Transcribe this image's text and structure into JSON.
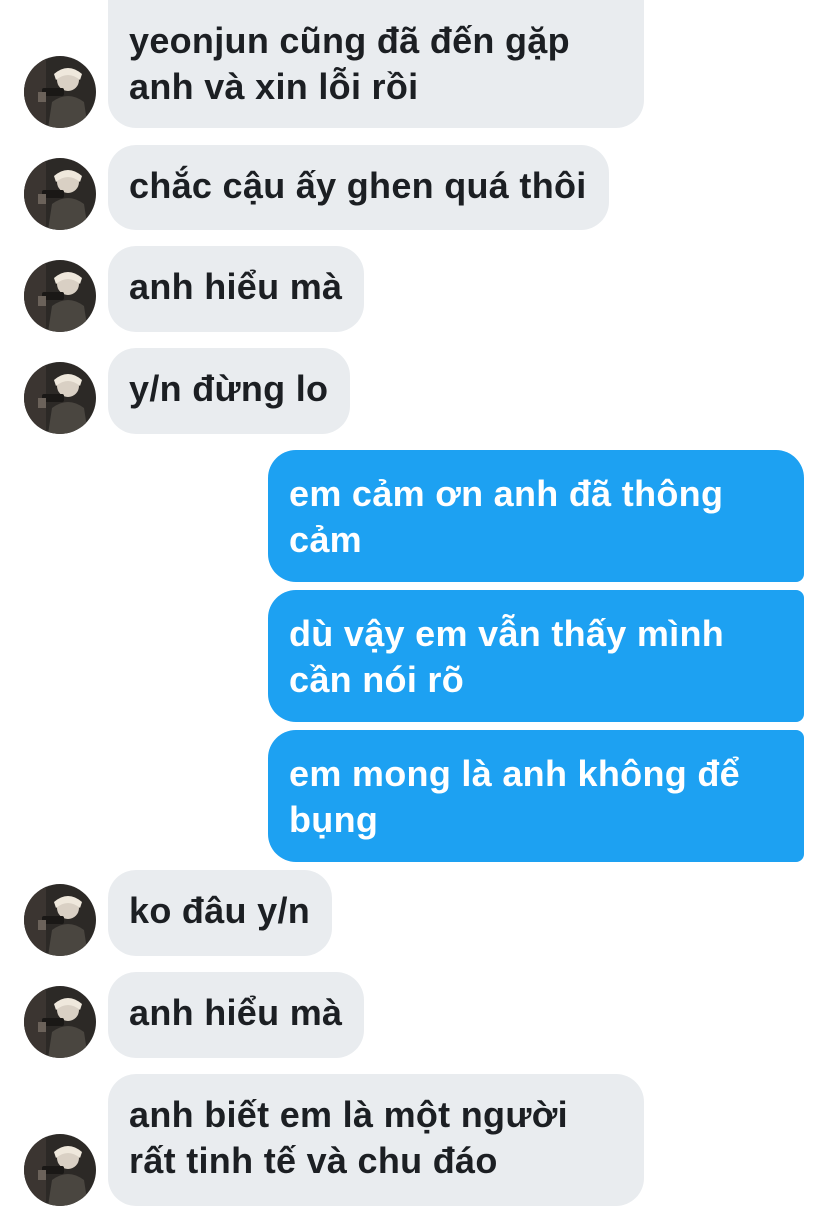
{
  "thread": {
    "messages": [
      {
        "side": "in",
        "lines": [
          "yeonjun cũng đã đến gặp",
          "anh và xin lỗi rồi"
        ]
      },
      {
        "side": "in",
        "lines": [
          "chắc cậu ấy ghen quá thôi"
        ]
      },
      {
        "side": "in",
        "lines": [
          "anh hiểu mà"
        ]
      },
      {
        "side": "in",
        "lines": [
          "y/n đừng lo"
        ]
      },
      {
        "side": "out",
        "lines": [
          "em cảm ơn anh đã thông",
          "cảm"
        ]
      },
      {
        "side": "out",
        "lines": [
          "dù vậy em vẫn thấy mình",
          "cần nói rõ"
        ]
      },
      {
        "side": "out",
        "lines": [
          "em mong là anh không để",
          "bụng"
        ]
      },
      {
        "side": "in",
        "lines": [
          "ko đâu y/n"
        ]
      },
      {
        "side": "in",
        "lines": [
          "anh hiểu mà"
        ]
      },
      {
        "side": "in",
        "lines": [
          "anh biết em là một người",
          "rất tinh tế và chu đáo"
        ]
      }
    ]
  },
  "colors": {
    "incoming_bubble": "#e9ecef",
    "incoming_text": "#1c1f23",
    "outgoing_bubble": "#1da1f2",
    "outgoing_text": "#ffffff"
  },
  "icons": {
    "avatar": "contact-avatar-photo"
  }
}
